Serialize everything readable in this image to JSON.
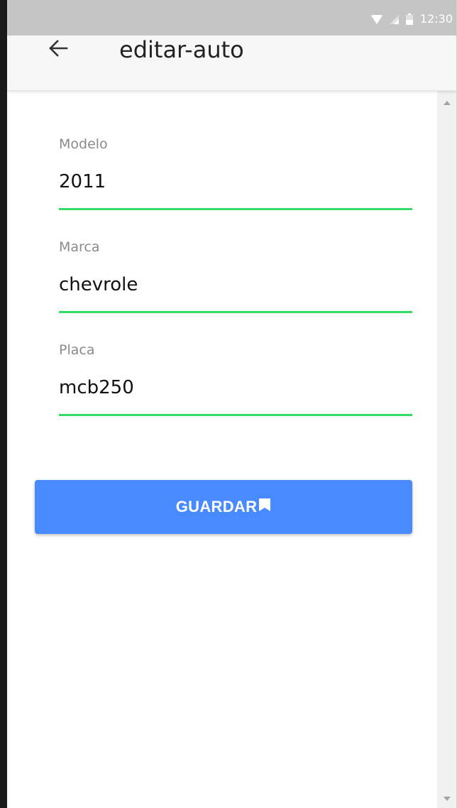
{
  "status_bar": {
    "time": "12:30",
    "icons": [
      "wifi-icon",
      "cellular-signal-icon",
      "battery-icon"
    ]
  },
  "header": {
    "title": "editar-auto",
    "back_icon": "arrow-left-icon"
  },
  "form": {
    "fields": [
      {
        "label": "Modelo",
        "value": "2011"
      },
      {
        "label": "Marca",
        "value": "chevrole"
      },
      {
        "label": "Placa",
        "value": "mcb250"
      }
    ],
    "save_label": "GUARDAR",
    "save_icon": "bookmark-icon"
  },
  "colors": {
    "statusbar": "#c5c5c5",
    "appbar": "#f7f7f7",
    "underline_valid": "#32db64",
    "primary_button": "#488aff"
  }
}
